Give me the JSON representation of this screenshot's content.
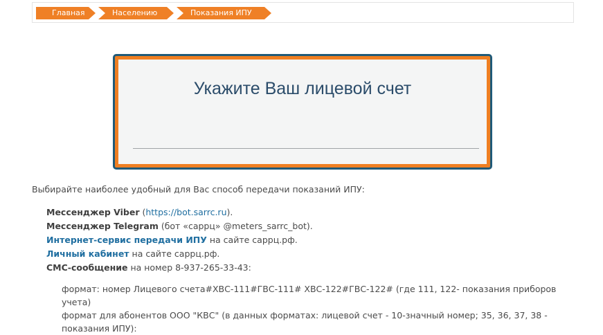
{
  "breadcrumb": {
    "items": [
      {
        "label": "Главная"
      },
      {
        "label": "Населению"
      },
      {
        "label": "Показания ИПУ"
      }
    ]
  },
  "account_form": {
    "title": "Укажите Ваш лицевой счет",
    "input_value": ""
  },
  "content": {
    "intro": "Выбирайте наиболее удобный для Вас способ передачи показаний ИПУ:",
    "viber": {
      "name": "Мессенджер Viber",
      "pre": " (",
      "link": "https://bot.sarrc.ru",
      "post": ")."
    },
    "telegram": {
      "name": "Мессенджер Telegram",
      "rest": " (бот «саррц» @meters_sarrc_bot)."
    },
    "internet": {
      "link": "Интернет-сервис передачи ИПУ",
      "rest": " на сайте саррц.рф."
    },
    "cabinet": {
      "link": "Личный кабинет",
      "rest": " на сайте саррц.рф."
    },
    "sms": {
      "name": "СМС-сообщение",
      "rest": " на номер 8-937-265-33-43:"
    },
    "format1": "формат: номер Лицевого счета#ХВС-111#ГВС-111# ХВС-122#ГВС-122# (где 111, 122- показания приборов учета)",
    "format2": "формат для абонентов ООО \"КВС\" (в данных форматах: лицевой счет - 10-значный номер; 35, 36, 37, 38 - показания ИПУ):"
  },
  "colors": {
    "accent": "#ef8026",
    "frame": "#1f5a79",
    "link": "#1f6ea0"
  }
}
